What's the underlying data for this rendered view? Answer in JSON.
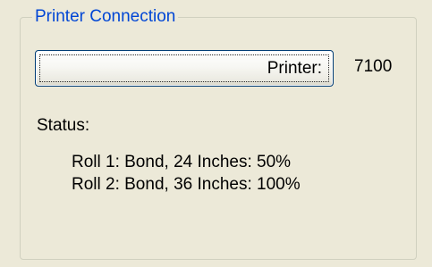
{
  "group": {
    "title": "Printer Connection"
  },
  "printer": {
    "button_label": "Printer:",
    "value": "7100"
  },
  "status": {
    "label": "Status:",
    "rolls": [
      "Roll 1: Bond, 24 Inches: 50%",
      "Roll 2: Bond, 36 Inches: 100%"
    ]
  },
  "colors": {
    "background": "#ece9d8",
    "group_title": "#0046d5",
    "button_border": "#003c74"
  }
}
